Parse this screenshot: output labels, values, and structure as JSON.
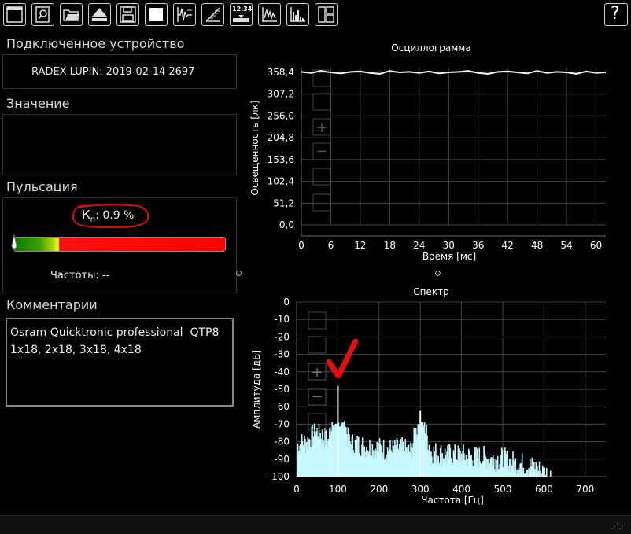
{
  "toolbar": {
    "buttons": [
      "window-icon",
      "search-icon",
      "open-folder-icon",
      "eject-icon",
      "save-icon",
      "stop-icon",
      "oscilloscope-icon",
      "comb-icon",
      "counter-icon",
      "waveform-icon",
      "spectrum-icon",
      "layout-icon"
    ],
    "counter_label": "12.34",
    "help_label": "?"
  },
  "device": {
    "title": "Подключенное устройство",
    "name": "RADEX LUPIN: 2019-02-14 2697"
  },
  "value": {
    "title": "Значение"
  },
  "pulsation": {
    "title": "Пульсация",
    "kp_label": "К",
    "kp_sub": "п",
    "kp_value": ": 0.9 %",
    "kp_fraction": 0.009,
    "freq_label": "Частоты: --"
  },
  "comments": {
    "title": "Комментарии",
    "text": "Osram Quicktronic professional  QTP8\n1x18, 2x18, 3x18, 4x18"
  },
  "oscillogram": {
    "title": "Осциллограмма",
    "ylabel": "Освещенность [лк]",
    "xlabel": "Время [мс]",
    "yticks": [
      "358,4",
      "307,2",
      "256,0",
      "204,8",
      "153,6",
      "102,4",
      "51,2",
      "0,0"
    ],
    "xticks": [
      "0",
      "6",
      "12",
      "18",
      "24",
      "30",
      "36",
      "42",
      "48",
      "54",
      "60"
    ],
    "line_color": "#e8f4f4"
  },
  "spectrum": {
    "title": "Спектр",
    "ylabel": "Амплитуда [дБ]",
    "xlabel": "Частота [Гц]",
    "yticks": [
      "0",
      "-10",
      "-20",
      "-30",
      "-40",
      "-50",
      "-60",
      "-70",
      "-80",
      "-90",
      "-100"
    ],
    "xticks": [
      "0",
      "100",
      "200",
      "300",
      "400",
      "500",
      "600",
      "700"
    ],
    "fill_color": "#c8f8ff"
  },
  "chart_data": [
    {
      "type": "line",
      "title": "Осциллограмма",
      "xlabel": "Время [мс]",
      "ylabel": "Освещенность [лк]",
      "xlim": [
        0,
        62
      ],
      "ylim": [
        0,
        358.4
      ],
      "grid": true,
      "x": [
        0,
        2,
        4,
        6,
        8,
        10,
        12,
        14,
        16,
        18,
        20,
        22,
        24,
        26,
        28,
        30,
        32,
        34,
        36,
        38,
        40,
        42,
        44,
        46,
        48,
        50,
        52,
        54,
        56,
        58,
        60,
        62
      ],
      "y": [
        358.4,
        358.2,
        358.6,
        358.3,
        358.1,
        358.4,
        358.5,
        358.2,
        358.0,
        358.6,
        358.3,
        358.4,
        358.2,
        358.5,
        358.1,
        358.3,
        358.4,
        358.6,
        358.2,
        358.0,
        358.4,
        358.5,
        358.3,
        358.1,
        358.6,
        358.2,
        358.4,
        358.3,
        358.0,
        358.5,
        358.2,
        358.3
      ]
    },
    {
      "type": "area",
      "title": "Спектр",
      "xlabel": "Частота [Гц]",
      "ylabel": "Амплитуда [дБ]",
      "xlim": [
        0,
        750
      ],
      "ylim": [
        -100,
        0
      ],
      "grid": true,
      "peaks": [
        {
          "x": 100,
          "y": -48
        },
        {
          "x": 300,
          "y": -62
        }
      ],
      "x": [
        0,
        25,
        50,
        75,
        100,
        125,
        150,
        175,
        200,
        225,
        250,
        275,
        300,
        325,
        350,
        375,
        400,
        425,
        450,
        475,
        500,
        525,
        550,
        575,
        600,
        625,
        650,
        700,
        750
      ],
      "y": [
        -80,
        -78,
        -72,
        -78,
        -48,
        -79,
        -80,
        -81,
        -82,
        -83,
        -82,
        -84,
        -62,
        -84,
        -85,
        -86,
        -86,
        -87,
        -87,
        -88,
        -88,
        -90,
        -91,
        -93,
        -96,
        -99,
        -100,
        -100,
        -100
      ]
    }
  ]
}
